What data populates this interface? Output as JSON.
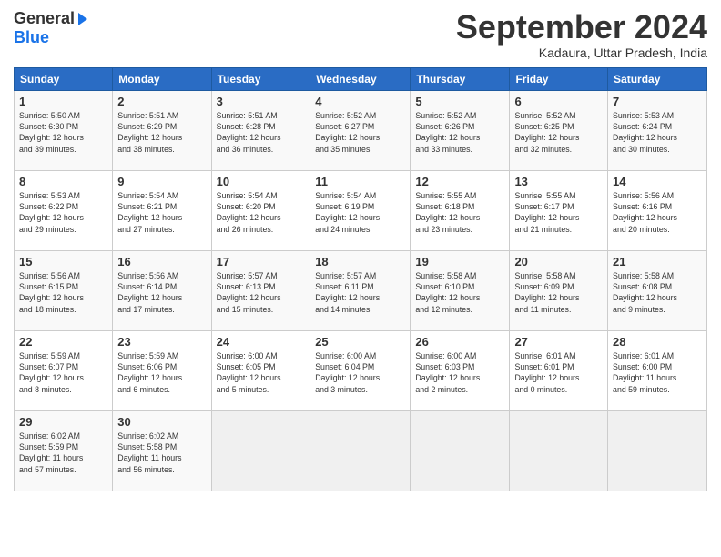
{
  "header": {
    "logo_general": "General",
    "logo_blue": "Blue",
    "month_title": "September 2024",
    "location": "Kadaura, Uttar Pradesh, India"
  },
  "weekdays": [
    "Sunday",
    "Monday",
    "Tuesday",
    "Wednesday",
    "Thursday",
    "Friday",
    "Saturday"
  ],
  "weeks": [
    [
      {
        "day": "1",
        "info": "Sunrise: 5:50 AM\nSunset: 6:30 PM\nDaylight: 12 hours\nand 39 minutes."
      },
      {
        "day": "2",
        "info": "Sunrise: 5:51 AM\nSunset: 6:29 PM\nDaylight: 12 hours\nand 38 minutes."
      },
      {
        "day": "3",
        "info": "Sunrise: 5:51 AM\nSunset: 6:28 PM\nDaylight: 12 hours\nand 36 minutes."
      },
      {
        "day": "4",
        "info": "Sunrise: 5:52 AM\nSunset: 6:27 PM\nDaylight: 12 hours\nand 35 minutes."
      },
      {
        "day": "5",
        "info": "Sunrise: 5:52 AM\nSunset: 6:26 PM\nDaylight: 12 hours\nand 33 minutes."
      },
      {
        "day": "6",
        "info": "Sunrise: 5:52 AM\nSunset: 6:25 PM\nDaylight: 12 hours\nand 32 minutes."
      },
      {
        "day": "7",
        "info": "Sunrise: 5:53 AM\nSunset: 6:24 PM\nDaylight: 12 hours\nand 30 minutes."
      }
    ],
    [
      {
        "day": "8",
        "info": "Sunrise: 5:53 AM\nSunset: 6:22 PM\nDaylight: 12 hours\nand 29 minutes."
      },
      {
        "day": "9",
        "info": "Sunrise: 5:54 AM\nSunset: 6:21 PM\nDaylight: 12 hours\nand 27 minutes."
      },
      {
        "day": "10",
        "info": "Sunrise: 5:54 AM\nSunset: 6:20 PM\nDaylight: 12 hours\nand 26 minutes."
      },
      {
        "day": "11",
        "info": "Sunrise: 5:54 AM\nSunset: 6:19 PM\nDaylight: 12 hours\nand 24 minutes."
      },
      {
        "day": "12",
        "info": "Sunrise: 5:55 AM\nSunset: 6:18 PM\nDaylight: 12 hours\nand 23 minutes."
      },
      {
        "day": "13",
        "info": "Sunrise: 5:55 AM\nSunset: 6:17 PM\nDaylight: 12 hours\nand 21 minutes."
      },
      {
        "day": "14",
        "info": "Sunrise: 5:56 AM\nSunset: 6:16 PM\nDaylight: 12 hours\nand 20 minutes."
      }
    ],
    [
      {
        "day": "15",
        "info": "Sunrise: 5:56 AM\nSunset: 6:15 PM\nDaylight: 12 hours\nand 18 minutes."
      },
      {
        "day": "16",
        "info": "Sunrise: 5:56 AM\nSunset: 6:14 PM\nDaylight: 12 hours\nand 17 minutes."
      },
      {
        "day": "17",
        "info": "Sunrise: 5:57 AM\nSunset: 6:13 PM\nDaylight: 12 hours\nand 15 minutes."
      },
      {
        "day": "18",
        "info": "Sunrise: 5:57 AM\nSunset: 6:11 PM\nDaylight: 12 hours\nand 14 minutes."
      },
      {
        "day": "19",
        "info": "Sunrise: 5:58 AM\nSunset: 6:10 PM\nDaylight: 12 hours\nand 12 minutes."
      },
      {
        "day": "20",
        "info": "Sunrise: 5:58 AM\nSunset: 6:09 PM\nDaylight: 12 hours\nand 11 minutes."
      },
      {
        "day": "21",
        "info": "Sunrise: 5:58 AM\nSunset: 6:08 PM\nDaylight: 12 hours\nand 9 minutes."
      }
    ],
    [
      {
        "day": "22",
        "info": "Sunrise: 5:59 AM\nSunset: 6:07 PM\nDaylight: 12 hours\nand 8 minutes."
      },
      {
        "day": "23",
        "info": "Sunrise: 5:59 AM\nSunset: 6:06 PM\nDaylight: 12 hours\nand 6 minutes."
      },
      {
        "day": "24",
        "info": "Sunrise: 6:00 AM\nSunset: 6:05 PM\nDaylight: 12 hours\nand 5 minutes."
      },
      {
        "day": "25",
        "info": "Sunrise: 6:00 AM\nSunset: 6:04 PM\nDaylight: 12 hours\nand 3 minutes."
      },
      {
        "day": "26",
        "info": "Sunrise: 6:00 AM\nSunset: 6:03 PM\nDaylight: 12 hours\nand 2 minutes."
      },
      {
        "day": "27",
        "info": "Sunrise: 6:01 AM\nSunset: 6:01 PM\nDaylight: 12 hours\nand 0 minutes."
      },
      {
        "day": "28",
        "info": "Sunrise: 6:01 AM\nSunset: 6:00 PM\nDaylight: 11 hours\nand 59 minutes."
      }
    ],
    [
      {
        "day": "29",
        "info": "Sunrise: 6:02 AM\nSunset: 5:59 PM\nDaylight: 11 hours\nand 57 minutes."
      },
      {
        "day": "30",
        "info": "Sunrise: 6:02 AM\nSunset: 5:58 PM\nDaylight: 11 hours\nand 56 minutes."
      },
      {
        "day": "",
        "info": ""
      },
      {
        "day": "",
        "info": ""
      },
      {
        "day": "",
        "info": ""
      },
      {
        "day": "",
        "info": ""
      },
      {
        "day": "",
        "info": ""
      }
    ]
  ]
}
